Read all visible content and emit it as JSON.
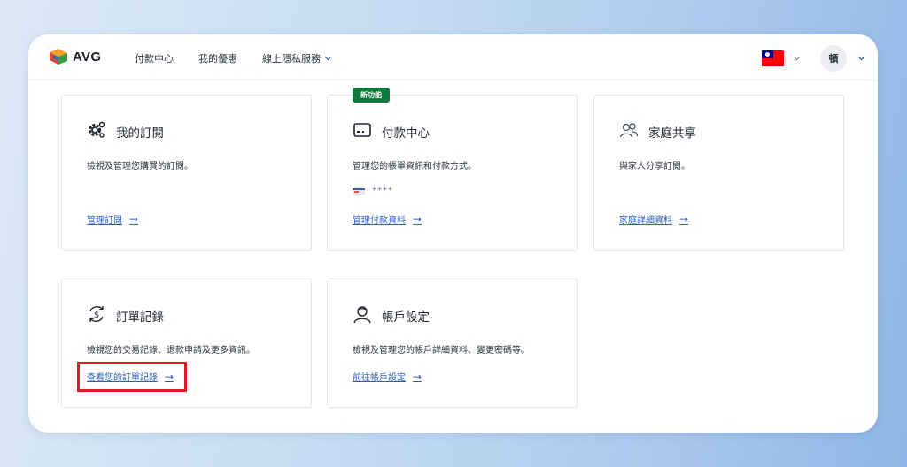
{
  "header": {
    "logo_text": "AVG",
    "nav": [
      {
        "label": "付款中心"
      },
      {
        "label": "我的優惠"
      },
      {
        "label": "線上隱私服務",
        "has_dropdown": true
      }
    ],
    "language_flag": "taiwan-flag-icon",
    "avatar_initial": "頓"
  },
  "cards": [
    {
      "title": "我的訂閱",
      "icon": "gear-icon",
      "description": "檢視及管理您購買的訂閱。",
      "link": "管理訂閱",
      "arrow": "→"
    },
    {
      "title": "付款中心",
      "icon": "payment-card-icon",
      "badge": "新功能",
      "description": "管理您的帳單資訊和付款方式。",
      "masked_card": "****",
      "link": "管理付款資料",
      "arrow": "→"
    },
    {
      "title": "家庭共享",
      "icon": "family-icon",
      "description": "與家人分享訂閱。",
      "link": "家庭詳細資料",
      "arrow": "→"
    },
    {
      "title": "訂單記錄",
      "icon": "dollar-refresh-icon",
      "description": "檢視您的交易記錄、退款申請及更多資訊。",
      "link": "查看您的訂單記錄",
      "arrow": "→",
      "highlighted": true
    },
    {
      "title": "帳戶設定",
      "icon": "user-icon",
      "description": "檢視及管理您的帳戶詳細資料、變更密碼等。",
      "link": "前往帳戶設定",
      "arrow": "→"
    }
  ],
  "colors": {
    "link": "#2a5fb7",
    "badge": "#0f7a3a",
    "highlight": "#e01a22"
  }
}
